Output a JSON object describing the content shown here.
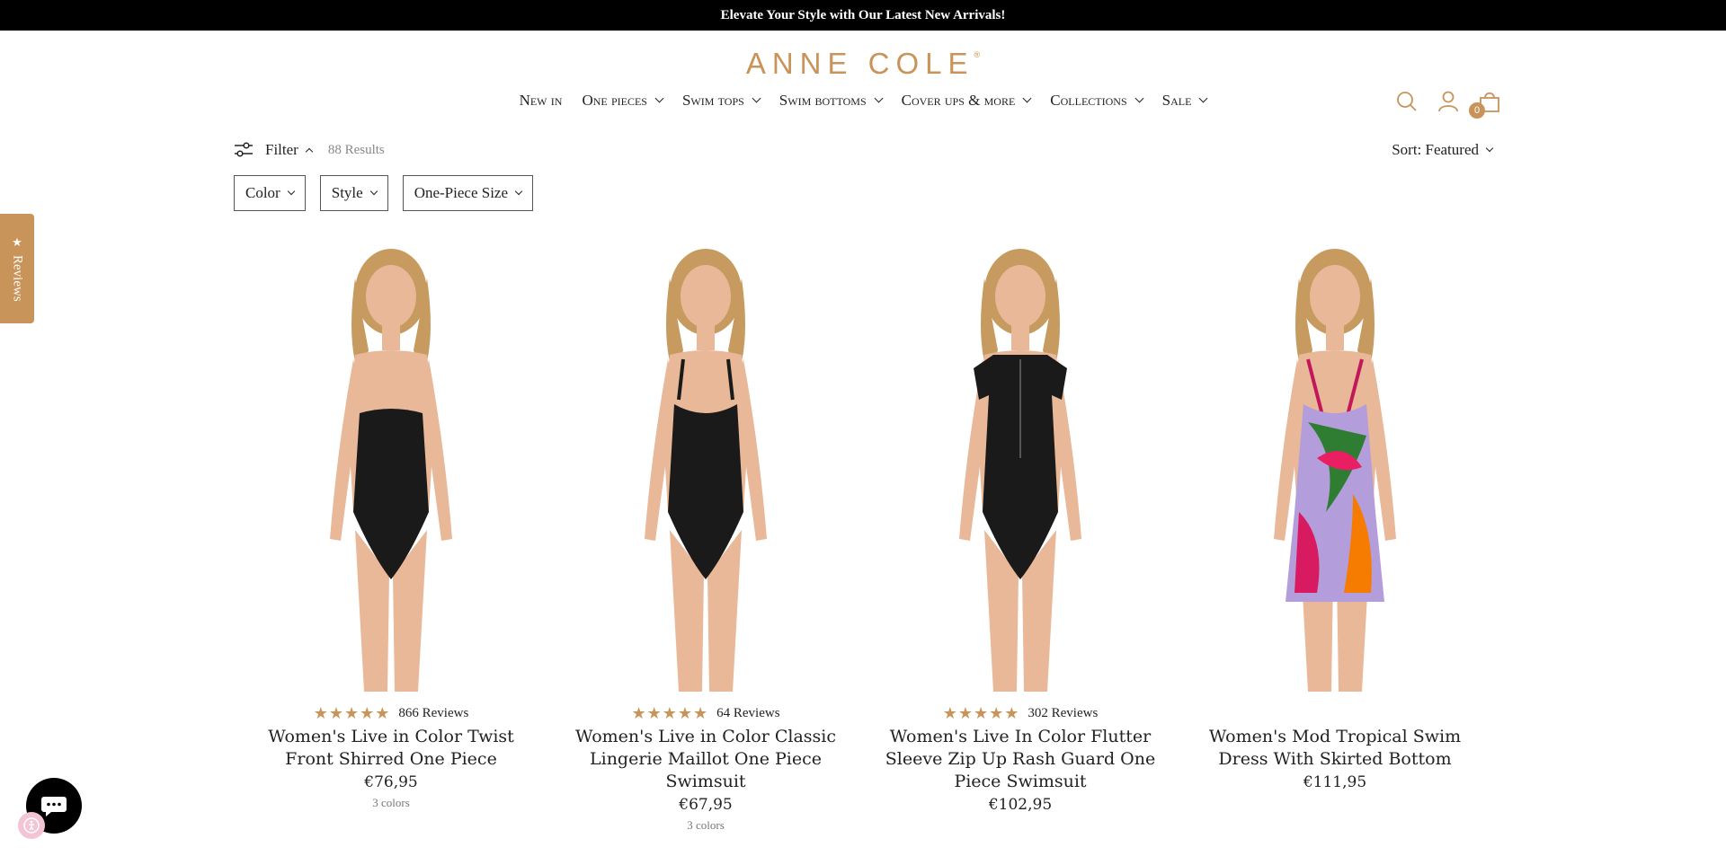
{
  "announcement": "Elevate Your Style with Our Latest New Arrivals!",
  "brand": {
    "name": "ANNE COLE",
    "mark": "®",
    "color": "#c8945a"
  },
  "nav": [
    {
      "label": "New in",
      "has_menu": false
    },
    {
      "label": "One pieces",
      "has_menu": true
    },
    {
      "label": "Swim tops",
      "has_menu": true
    },
    {
      "label": "Swim bottoms",
      "has_menu": true
    },
    {
      "label": "Cover ups & more",
      "has_menu": true
    },
    {
      "label": "Collections",
      "has_menu": true
    },
    {
      "label": "Sale",
      "has_menu": true
    }
  ],
  "header_icons": {
    "search": "search-icon",
    "account": "account-icon",
    "cart": "bag-icon",
    "cart_count": "0"
  },
  "toolbar": {
    "filter_label": "Filter",
    "results": "88 Results",
    "sort_label": "Sort: Featured"
  },
  "filters": [
    "Color",
    "Style",
    "One-Piece Size"
  ],
  "reviews_tab": "Reviews",
  "products": [
    {
      "title": "Women's Live in Color Twist Front Shirred One Piece",
      "price": "€76,95",
      "reviews": "866 Reviews",
      "rating": 5,
      "colors": "3 colors",
      "swimsuit": "bandeau"
    },
    {
      "title": "Women's Live in Color Classic Lingerie Maillot One Piece Swimsuit",
      "price": "€67,95",
      "reviews": "64 Reviews",
      "rating": 4.5,
      "colors": "3 colors",
      "swimsuit": "maillot"
    },
    {
      "title": "Women's Live In Color Flutter Sleeve Zip Up Rash Guard One Piece Swimsuit",
      "price": "€102,95",
      "reviews": "302 Reviews",
      "rating": 4.5,
      "colors": "",
      "swimsuit": "rashguard"
    },
    {
      "title": "Women's Mod Tropical Swim Dress With Skirted Bottom",
      "price": "€111,95",
      "reviews": "",
      "rating": 0,
      "colors": "",
      "swimsuit": "dress"
    }
  ]
}
